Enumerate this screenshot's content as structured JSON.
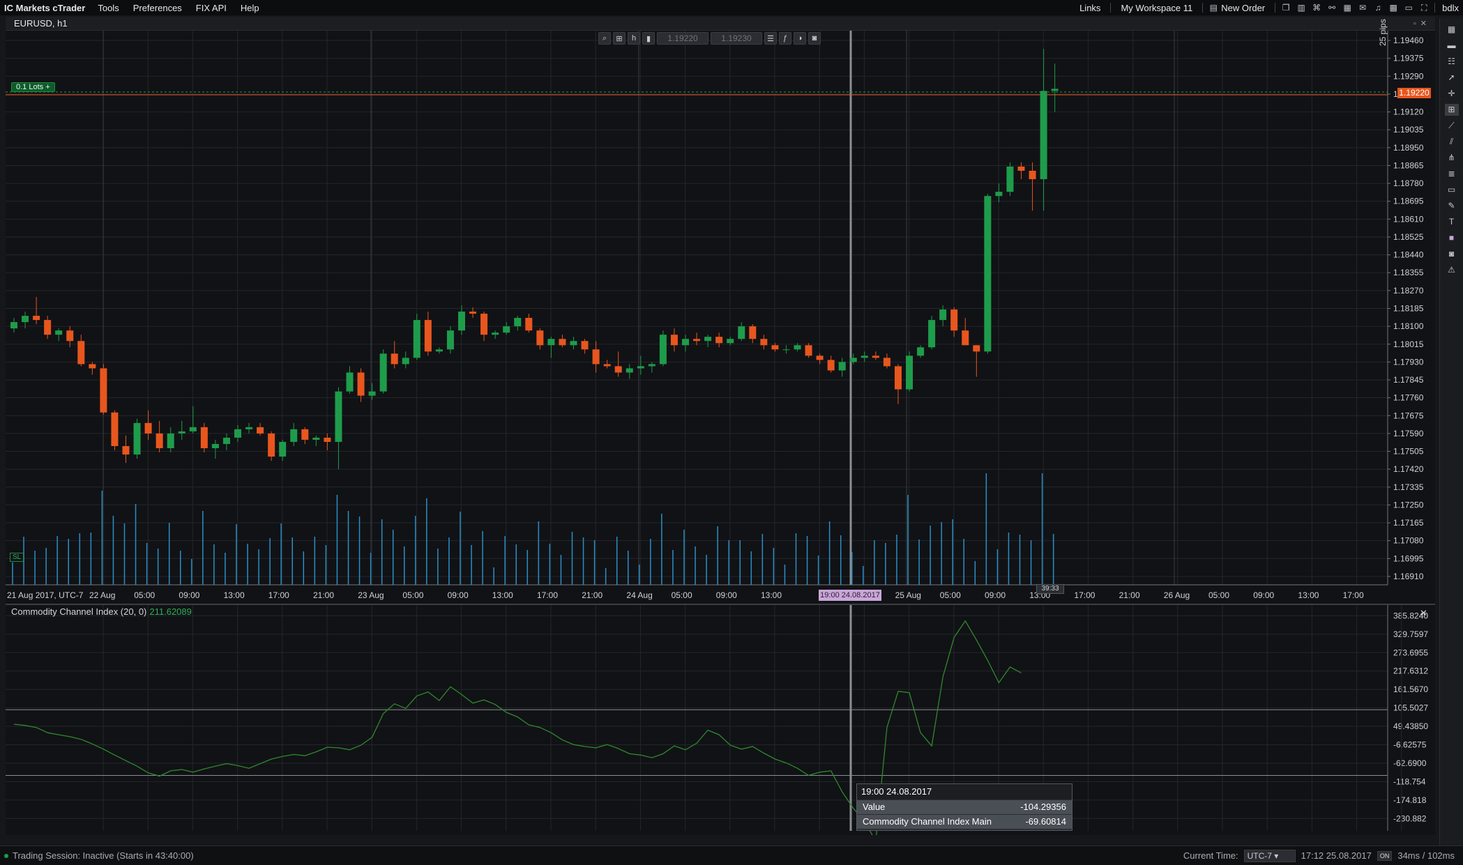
{
  "menu": {
    "brand": "IC Markets cTrader",
    "items": [
      "Tools",
      "Preferences",
      "FIX API",
      "Help"
    ],
    "right": {
      "links": "Links",
      "workspace": "My Workspace 11",
      "new_order": "New Order",
      "user": "bdlx"
    }
  },
  "chart": {
    "title": "EURUSD, h1",
    "lots_label": "0.1 Lots",
    "lots_plus": "+",
    "sl_label": "SL",
    "pips_label": "25 pips",
    "bid_price_btn": "1.19220",
    "ask_price_btn": "1.19230",
    "current_price_tag": "1.19220",
    "hover_time_tag": "19:00 24.08.2017",
    "candle_countdown": "39:33",
    "price_axis": [
      "1.19460",
      "1.19375",
      "1.19290",
      "1.19205",
      "1.19120",
      "1.19035",
      "1.18950",
      "1.18865",
      "1.18780",
      "1.18695",
      "1.18610",
      "1.18525",
      "1.18440",
      "1.18355",
      "1.18270",
      "1.18185",
      "1.18100",
      "1.18015",
      "1.17930",
      "1.17845",
      "1.17760",
      "1.17675",
      "1.17590",
      "1.17505",
      "1.17420",
      "1.17335",
      "1.17250",
      "1.17165",
      "1.17080",
      "1.16995",
      "1.16910"
    ],
    "time_axis": [
      "21 Aug 2017, UTC-7",
      "22 Aug",
      "05:00",
      "09:00",
      "13:00",
      "17:00",
      "21:00",
      "23 Aug",
      "05:00",
      "09:00",
      "13:00",
      "17:00",
      "21:00",
      "24 Aug",
      "05:00",
      "09:00",
      "13:00",
      "",
      "00",
      "25 Aug",
      "05:00",
      "09:00",
      "13:00",
      "17:00",
      "21:00",
      "26 Aug",
      "05:00",
      "09:00",
      "13:00",
      "17:00"
    ],
    "colors": {
      "bull": "#1e9c4b",
      "bear": "#e8561e",
      "volume": "#2a8fc7",
      "cci": "#2e8a2e"
    }
  },
  "chart_data": [
    {
      "type": "candlestick",
      "title": "EURUSD, h1",
      "ylim": [
        1.1687,
        1.195
      ],
      "candles": [
        [
          1.1809,
          1.1814,
          1.1807,
          1.1812
        ],
        [
          1.1812,
          1.1817,
          1.1809,
          1.1815
        ],
        [
          1.1815,
          1.1824,
          1.1811,
          1.1813
        ],
        [
          1.1813,
          1.1815,
          1.1804,
          1.1806
        ],
        [
          1.1806,
          1.1809,
          1.1803,
          1.1808
        ],
        [
          1.1808,
          1.181,
          1.18,
          1.1803
        ],
        [
          1.1803,
          1.1806,
          1.1791,
          1.1792
        ],
        [
          1.1792,
          1.1793,
          1.1787,
          1.179
        ],
        [
          1.179,
          1.1792,
          1.1768,
          1.1769
        ],
        [
          1.1769,
          1.177,
          1.1751,
          1.1753
        ],
        [
          1.1753,
          1.1758,
          1.1745,
          1.1749
        ],
        [
          1.1749,
          1.1766,
          1.1747,
          1.1764
        ],
        [
          1.1764,
          1.177,
          1.1756,
          1.1759
        ],
        [
          1.1759,
          1.1765,
          1.175,
          1.1752
        ],
        [
          1.1752,
          1.1762,
          1.175,
          1.1759
        ],
        [
          1.1759,
          1.1765,
          1.1756,
          1.176
        ],
        [
          1.176,
          1.1772,
          1.1759,
          1.1762
        ],
        [
          1.1762,
          1.1764,
          1.175,
          1.1752
        ],
        [
          1.1752,
          1.1756,
          1.1747,
          1.1754
        ],
        [
          1.1754,
          1.1759,
          1.1751,
          1.1757
        ],
        [
          1.1757,
          1.1763,
          1.1755,
          1.1761
        ],
        [
          1.1761,
          1.1764,
          1.1759,
          1.1762
        ],
        [
          1.1762,
          1.1764,
          1.1758,
          1.1759
        ],
        [
          1.1759,
          1.176,
          1.1746,
          1.1748
        ],
        [
          1.1748,
          1.1756,
          1.1746,
          1.1755
        ],
        [
          1.1755,
          1.1764,
          1.1753,
          1.1761
        ],
        [
          1.1761,
          1.1762,
          1.1754,
          1.1756
        ],
        [
          1.1756,
          1.1758,
          1.1753,
          1.1757
        ],
        [
          1.1757,
          1.1759,
          1.1751,
          1.1755
        ],
        [
          1.1755,
          1.1781,
          1.1742,
          1.1779
        ],
        [
          1.1779,
          1.1791,
          1.1778,
          1.1788
        ],
        [
          1.1788,
          1.179,
          1.1774,
          1.1777
        ],
        [
          1.1777,
          1.1783,
          1.1775,
          1.1779
        ],
        [
          1.1779,
          1.1799,
          1.1778,
          1.1797
        ],
        [
          1.1797,
          1.1803,
          1.179,
          1.1792
        ],
        [
          1.1792,
          1.1798,
          1.179,
          1.1795
        ],
        [
          1.1795,
          1.1816,
          1.1794,
          1.1813
        ],
        [
          1.1813,
          1.1817,
          1.1796,
          1.1798
        ],
        [
          1.1798,
          1.18,
          1.1797,
          1.1799
        ],
        [
          1.1799,
          1.181,
          1.1797,
          1.1808
        ],
        [
          1.1808,
          1.182,
          1.1806,
          1.1817
        ],
        [
          1.1817,
          1.1819,
          1.1814,
          1.1816
        ],
        [
          1.1816,
          1.1817,
          1.1803,
          1.1806
        ],
        [
          1.1806,
          1.1808,
          1.1804,
          1.1807
        ],
        [
          1.1807,
          1.1812,
          1.1806,
          1.181
        ],
        [
          1.181,
          1.1815,
          1.1808,
          1.1814
        ],
        [
          1.1814,
          1.1816,
          1.1807,
          1.1808
        ],
        [
          1.1808,
          1.1809,
          1.1799,
          1.1801
        ],
        [
          1.1801,
          1.1805,
          1.1795,
          1.1804
        ],
        [
          1.1804,
          1.1806,
          1.18,
          1.1801
        ],
        [
          1.1801,
          1.1805,
          1.1799,
          1.1803
        ],
        [
          1.1803,
          1.1804,
          1.1797,
          1.1799
        ],
        [
          1.1799,
          1.1803,
          1.1788,
          1.1792
        ],
        [
          1.1792,
          1.1794,
          1.179,
          1.1791
        ],
        [
          1.1791,
          1.1798,
          1.1786,
          1.1788
        ],
        [
          1.1788,
          1.1792,
          1.1785,
          1.179
        ],
        [
          1.179,
          1.1796,
          1.1787,
          1.1791
        ],
        [
          1.1791,
          1.1793,
          1.1788,
          1.1792
        ],
        [
          1.1792,
          1.1808,
          1.1791,
          1.1806
        ],
        [
          1.1806,
          1.1809,
          1.1798,
          1.1801
        ],
        [
          1.1801,
          1.1806,
          1.1798,
          1.1804
        ],
        [
          1.1804,
          1.1807,
          1.1801,
          1.1803
        ],
        [
          1.1803,
          1.1806,
          1.18,
          1.1805
        ],
        [
          1.1805,
          1.1807,
          1.18,
          1.1802
        ],
        [
          1.1802,
          1.1805,
          1.1801,
          1.1804
        ],
        [
          1.1804,
          1.1812,
          1.1803,
          1.181
        ],
        [
          1.181,
          1.1811,
          1.1802,
          1.1804
        ],
        [
          1.1804,
          1.1806,
          1.1799,
          1.1801
        ],
        [
          1.1801,
          1.1802,
          1.1798,
          1.1799
        ],
        [
          1.1799,
          1.1801,
          1.1797,
          1.1799
        ],
        [
          1.1799,
          1.1802,
          1.1798,
          1.1801
        ],
        [
          1.1801,
          1.1802,
          1.1795,
          1.1796
        ],
        [
          1.1796,
          1.1797,
          1.1792,
          1.1794
        ],
        [
          1.1794,
          1.1796,
          1.1788,
          1.1789
        ],
        [
          1.1789,
          1.1795,
          1.1786,
          1.1793
        ],
        [
          1.1793,
          1.1797,
          1.1792,
          1.1795
        ],
        [
          1.1795,
          1.1798,
          1.1793,
          1.1796
        ],
        [
          1.1796,
          1.1798,
          1.1794,
          1.1795
        ],
        [
          1.1795,
          1.1797,
          1.179,
          1.1791
        ],
        [
          1.1791,
          1.1792,
          1.1773,
          1.178
        ],
        [
          1.178,
          1.1798,
          1.1779,
          1.1796
        ],
        [
          1.1796,
          1.1801,
          1.1795,
          1.18
        ],
        [
          1.18,
          1.1815,
          1.1799,
          1.1813
        ],
        [
          1.1813,
          1.182,
          1.181,
          1.1818
        ],
        [
          1.1818,
          1.1819,
          1.1805,
          1.1808
        ],
        [
          1.1808,
          1.1814,
          1.1803,
          1.1801
        ],
        [
          1.1801,
          1.1801,
          1.1786,
          1.1798
        ],
        [
          1.1798,
          1.1873,
          1.1797,
          1.1872
        ],
        [
          1.1872,
          1.1878,
          1.1869,
          1.1874
        ],
        [
          1.1874,
          1.1888,
          1.1872,
          1.1886
        ],
        [
          1.1886,
          1.1888,
          1.188,
          1.1884
        ],
        [
          1.1884,
          1.1888,
          1.1865,
          1.188
        ],
        [
          1.188,
          1.1942,
          1.1865,
          1.1922
        ],
        [
          1.1922,
          1.1935,
          1.1912,
          1.1923
        ]
      ],
      "volume_max": 1.0
    },
    {
      "type": "line",
      "title": "Commodity Channel Index (20, 0)",
      "current_value": "211.62089",
      "ylim": [
        -260,
        410
      ],
      "levels": [
        100,
        -100
      ],
      "y_ticks": [
        "385.8240",
        "329.7597",
        "273.6955",
        "217.6312",
        "161.5670",
        "105.5027",
        "49.43850",
        "-6.62575",
        "-62.6900",
        "-118.754",
        "-174.818",
        "-230.882"
      ],
      "values": [
        56,
        52,
        46,
        30,
        24,
        18,
        10,
        -4,
        -20,
        -38,
        -55,
        -72,
        -92,
        -102,
        -86,
        -82,
        -90,
        -80,
        -72,
        -64,
        -70,
        -78,
        -64,
        -50,
        -42,
        -36,
        -40,
        -28,
        -14,
        -16,
        -22,
        -8,
        16,
        88,
        118,
        104,
        142,
        154,
        128,
        170,
        146,
        120,
        130,
        116,
        92,
        78,
        54,
        46,
        30,
        8,
        -6,
        -12,
        -16,
        -6,
        -18,
        -34,
        -38,
        -46,
        -34,
        -10,
        -22,
        -2,
        38,
        24,
        -8,
        -20,
        -12,
        -32,
        -50,
        -62,
        -78,
        -100,
        -90,
        -86,
        -150,
        -200,
        -240,
        -300,
        46,
        156,
        152,
        30,
        -10,
        200,
        320,
        370,
        312,
        250,
        182,
        230,
        212
      ],
      "tooltip": {
        "time": "19:00 24.08.2017",
        "rows": [
          {
            "label": "Value",
            "value": "-104.29356"
          },
          {
            "label": "Commodity Channel Index Main",
            "value": "-69.60814"
          }
        ]
      }
    }
  ],
  "status": {
    "session": "Trading Session: Inactive (Starts in 43:40:00)",
    "current_time_label": "Current Time:",
    "timezone": "UTC-7",
    "datetime": "17:12 25.08.2017",
    "toggle": "ON",
    "latency": "34ms / 102ms"
  }
}
